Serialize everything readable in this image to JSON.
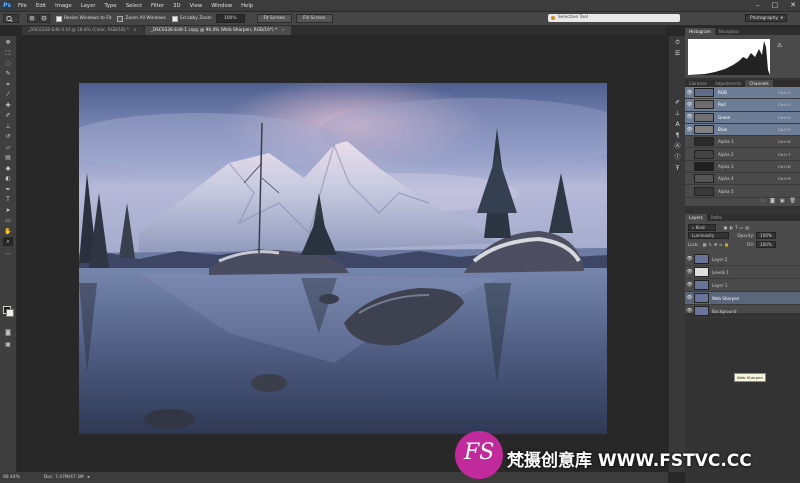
{
  "menubar": {
    "app_logo": "Ps",
    "items": [
      "File",
      "Edit",
      "Image",
      "Layer",
      "Type",
      "Select",
      "Filter",
      "3D",
      "View",
      "Window",
      "Help"
    ],
    "window_controls": [
      "–",
      "□",
      "✕"
    ]
  },
  "options_bar": {
    "resize_windows": "Resize Windows to Fit",
    "zoom_all": "Zoom All Windows",
    "scrubby_zoom": "Scrubby Zoom",
    "zoom_value": "100%",
    "fit_screen": "Fit Screen",
    "fill_screen": "Fill Screen",
    "search_tool": "Selective Tool",
    "workspace": "Photography"
  },
  "tabs": [
    {
      "label": "_DSC0336-Edit-5.tif @ 18.6% (Color, RGB/16) *",
      "active": false
    },
    {
      "label": "_DSC0336-Edit-1 copy @ 90.4% (Web Sharpen, RGB/16*) *",
      "active": true
    }
  ],
  "status": {
    "zoom": "90.44%",
    "doc": "Doc: 7.47M/47.3M"
  },
  "histogram_panel": {
    "tabs": [
      "Histogram",
      "Navigator"
    ]
  },
  "channels_panel": {
    "tabs": [
      "Libraries",
      "Adjustments",
      "Channels"
    ],
    "channels": [
      {
        "name": "RGB",
        "shortcut": "Ctrl+2",
        "selected": true,
        "visible": true,
        "thumb": "#5f6d8a"
      },
      {
        "name": "Red",
        "shortcut": "Ctrl+3",
        "selected": true,
        "visible": true,
        "thumb": "#6e6e6e"
      },
      {
        "name": "Green",
        "shortcut": "Ctrl+4",
        "selected": true,
        "visible": true,
        "thumb": "#707070"
      },
      {
        "name": "Blue",
        "shortcut": "Ctrl+5",
        "selected": true,
        "visible": true,
        "thumb": "#808080"
      },
      {
        "name": "Alpha 1",
        "shortcut": "Ctrl+6",
        "selected": false,
        "visible": false,
        "thumb": "#2a2a2a"
      },
      {
        "name": "Alpha 2",
        "shortcut": "Ctrl+7",
        "selected": false,
        "visible": false,
        "thumb": "#444"
      },
      {
        "name": "Alpha 3",
        "shortcut": "Ctrl+8",
        "selected": false,
        "visible": false,
        "thumb": "#1f1f1f"
      },
      {
        "name": "Alpha 4",
        "shortcut": "Ctrl+9",
        "selected": false,
        "visible": false,
        "thumb": "#555"
      },
      {
        "name": "Alpha 5",
        "shortcut": "",
        "selected": false,
        "visible": false,
        "thumb": "#3a3a3a"
      }
    ]
  },
  "layers_panel": {
    "tabs": [
      "Layers",
      "Paths"
    ],
    "kind": "Kind",
    "blend_mode": "Luminosity",
    "opacity_label": "Opacity:",
    "opacity": "100%",
    "lock_label": "Lock:",
    "fill_label": "Fill:",
    "fill": "100%",
    "layers": [
      {
        "name": "Layer 2",
        "selected": false
      },
      {
        "name": "Levels 1",
        "selected": false
      },
      {
        "name": "Layer 1",
        "selected": false
      },
      {
        "name": "Web Sharpen",
        "selected": true
      },
      {
        "name": "Background",
        "selected": false
      }
    ],
    "tooltip": "Web Sharpen"
  },
  "watermark": {
    "logo_letters": "FS",
    "text": "梵摄创意库 WWW.FSTVC.CC"
  },
  "colors": {
    "fg": "#1a1a1a",
    "bg": "#f2ece8",
    "selection": "#6d7d96"
  }
}
